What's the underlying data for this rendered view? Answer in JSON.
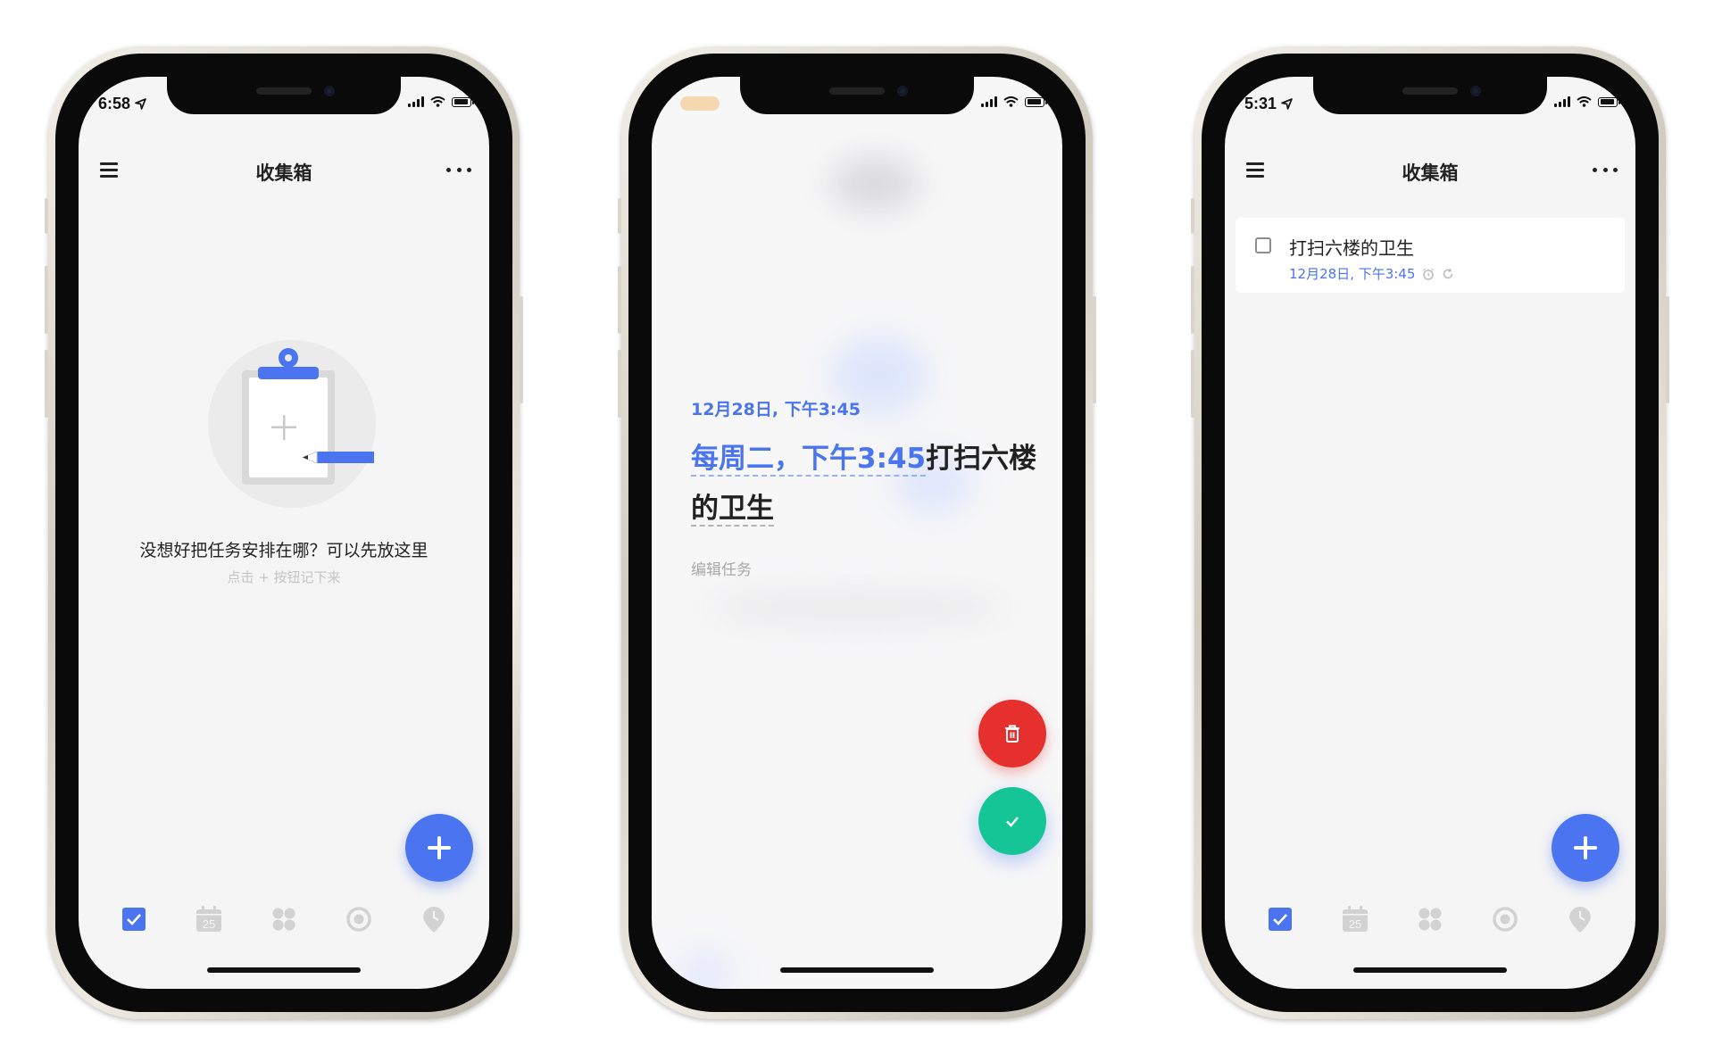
{
  "colors": {
    "accent": "#4a74f0",
    "danger": "#e5302e",
    "success": "#16c596",
    "hint": "#c4c4c4"
  },
  "phones": [
    {
      "status_time": "6:58",
      "header": {
        "title": "收集箱"
      },
      "empty_state": {
        "title": "没想好把任务安排在哪？可以先放这里",
        "hint": "点击 + 按钮记下来"
      },
      "tabs": [
        "checkbox-icon",
        "calendar-icon",
        "grid-icon",
        "focus-icon",
        "pin-icon"
      ],
      "calendar_day": "25"
    },
    {
      "editor": {
        "date": "12月28日, 下午3:45",
        "title_highlight": "每周二，下午3:45",
        "title_rest_1": "打扫六楼",
        "title_rest_2": "的卫生",
        "placeholder": "编辑任务"
      }
    },
    {
      "status_time": "5:31",
      "header": {
        "title": "收集箱"
      },
      "task": {
        "title": "打扫六楼的卫生",
        "meta": "12月28日, 下午3:45"
      },
      "tabs": [
        "checkbox-icon",
        "calendar-icon",
        "grid-icon",
        "focus-icon",
        "pin-icon"
      ],
      "calendar_day": "25"
    }
  ]
}
